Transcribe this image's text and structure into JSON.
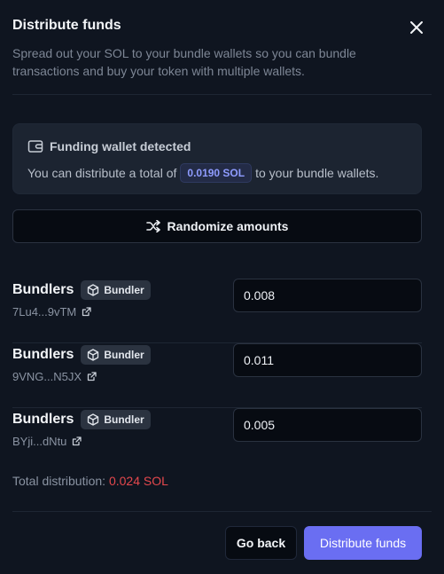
{
  "modal": {
    "title": "Distribute funds",
    "subtitle": "Spread out your SOL to your bundle wallets so you can bundle transactions and buy your token with multiple wallets."
  },
  "funding": {
    "title": "Funding wallet detected",
    "text_before": "You can distribute a total of",
    "amount": "0.0190 SOL",
    "text_after": "to your bundle wallets."
  },
  "randomize_label": "Randomize amounts",
  "bundlers": [
    {
      "label": "Bundlers",
      "badge": "Bundler",
      "address": "7Lu4...9vTM",
      "amount": "0.008"
    },
    {
      "label": "Bundlers",
      "badge": "Bundler",
      "address": "9VNG...N5JX",
      "amount": "0.011"
    },
    {
      "label": "Bundlers",
      "badge": "Bundler",
      "address": "BYji...dNtu",
      "amount": "0.005"
    }
  ],
  "total": {
    "label": "Total distribution:",
    "value": "0.024 SOL"
  },
  "buttons": {
    "go_back": "Go back",
    "distribute": "Distribute funds"
  },
  "colors": {
    "accent": "#6a6ef2",
    "error": "#e5484d",
    "background": "#0f1520"
  },
  "icons": [
    "close-icon",
    "wallet-icon",
    "shuffle-icon",
    "cube-icon",
    "external-link-icon"
  ]
}
